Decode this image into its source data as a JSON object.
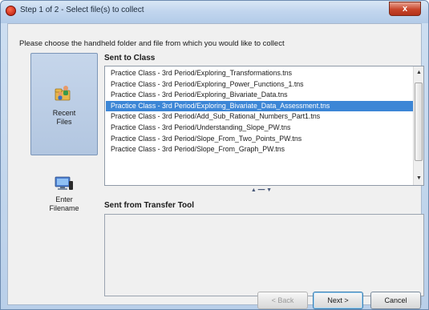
{
  "window": {
    "title": "Step 1 of 2 - Select file(s) to collect",
    "close_label": "x"
  },
  "instruction": "Please choose the handheld folder and file from which you would like to collect",
  "sidebar": {
    "recent_files": {
      "line1": "Recent",
      "line2": "Files",
      "icon": "folder-people-icon",
      "selected": true
    },
    "enter_filename": {
      "line1": "Enter",
      "line2": "Filename",
      "icon": "computer-icon",
      "selected": false
    }
  },
  "sent_to_class": {
    "label": "Sent to Class",
    "items": [
      "Practice Class - 3rd Period/Exploring_Transformations.tns",
      "Practice Class - 3rd Period/Exploring_Power_Functions_1.tns",
      "Practice Class - 3rd Period/Exploring_Bivariate_Data.tns",
      "Practice Class - 3rd Period/Exploring_Bivariate_Data_Assessment.tns",
      "Practice Class - 3rd Period/Add_Sub_Rational_Numbers_Part1.tns",
      "Practice Class - 3rd Period/Understanding_Slope_PW.tns",
      "Practice Class - 3rd Period/Slope_From_Two_Points_PW.tns",
      "Practice Class - 3rd Period/Slope_From_Graph_PW.tns"
    ],
    "selected_index": 3
  },
  "sent_from_transfer_tool": {
    "label": "Sent from Transfer Tool",
    "items": []
  },
  "buttons": {
    "back": "< Back",
    "next": "Next >",
    "cancel": "Cancel"
  },
  "colors": {
    "selection": "#3c86d6",
    "sidebar_selected": "#b8cbe4",
    "close_button": "#c8452a"
  }
}
